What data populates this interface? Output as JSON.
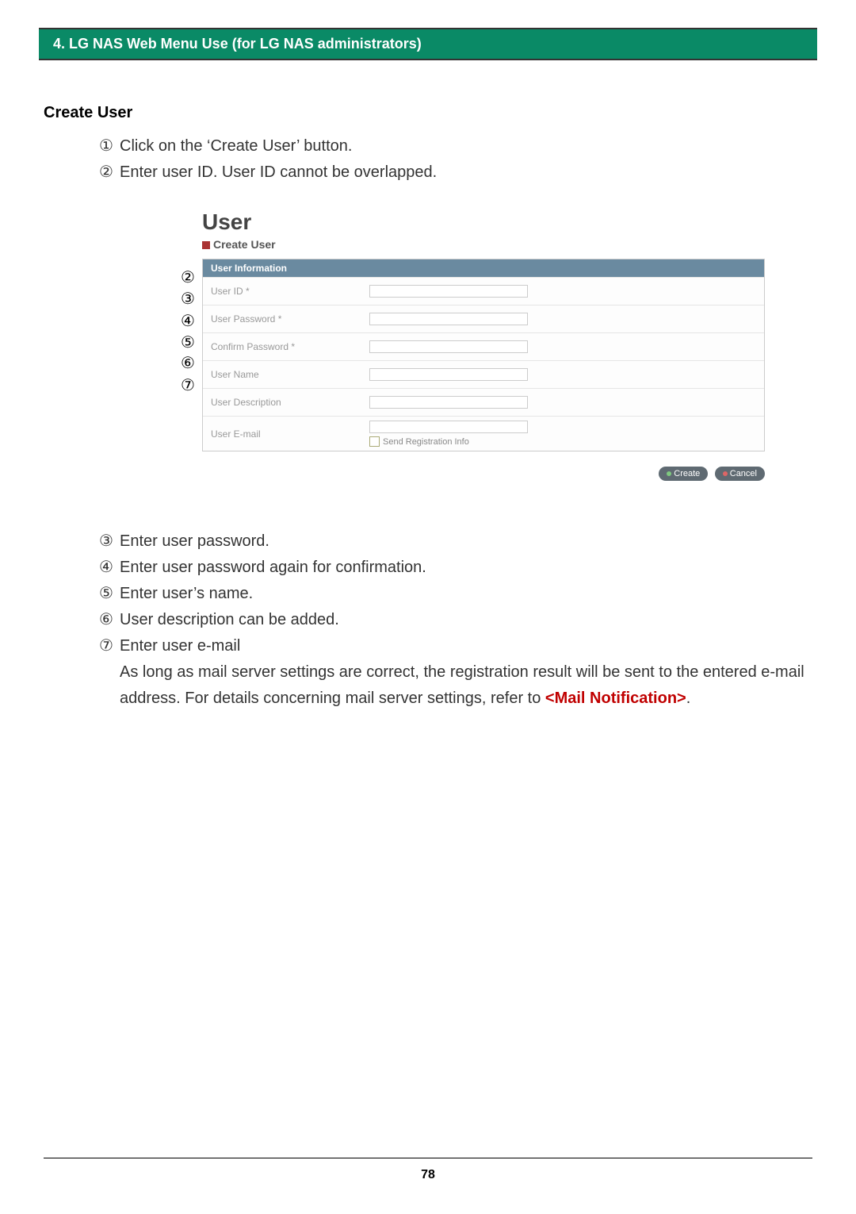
{
  "header": "4. LG NAS Web Menu Use (for LG NAS administrators)",
  "section_title": "Create User",
  "instructions_top": [
    {
      "num": "①",
      "text": "Click on the ‘Create User’ button."
    },
    {
      "num": "②",
      "text": "Enter user ID. User ID cannot be overlapped."
    }
  ],
  "instructions_bottom": [
    {
      "num": "③",
      "text": "Enter user password."
    },
    {
      "num": "④",
      "text": "Enter user password again for confirmation."
    },
    {
      "num": "⑤",
      "text": "Enter user’s name."
    },
    {
      "num": "⑥",
      "text": "User description can be added."
    },
    {
      "num": "⑦",
      "text": "Enter user e-mail"
    }
  ],
  "instructions_note": "As long as mail server settings are correct, the registration result will be sent to the entered e-mail address. For details concerning mail server settings, refer to ",
  "link_text": "<Mail Notification>",
  "note_tail": ".",
  "screenshot": {
    "title": "User",
    "subtitle": "Create User",
    "panel_head": "User Information",
    "rows": [
      "User ID *",
      "User Password *",
      "Confirm Password *",
      "User Name",
      "User Description",
      "User E-mail"
    ],
    "checkbox_label": "Send Registration Info",
    "btn_create": "Create",
    "btn_cancel": "Cancel",
    "callouts": {
      "c2": "②",
      "c3": "③",
      "c4": "④",
      "c5": "⑤",
      "c6": "⑥",
      "c7": "⑦"
    }
  },
  "page_number": "78"
}
